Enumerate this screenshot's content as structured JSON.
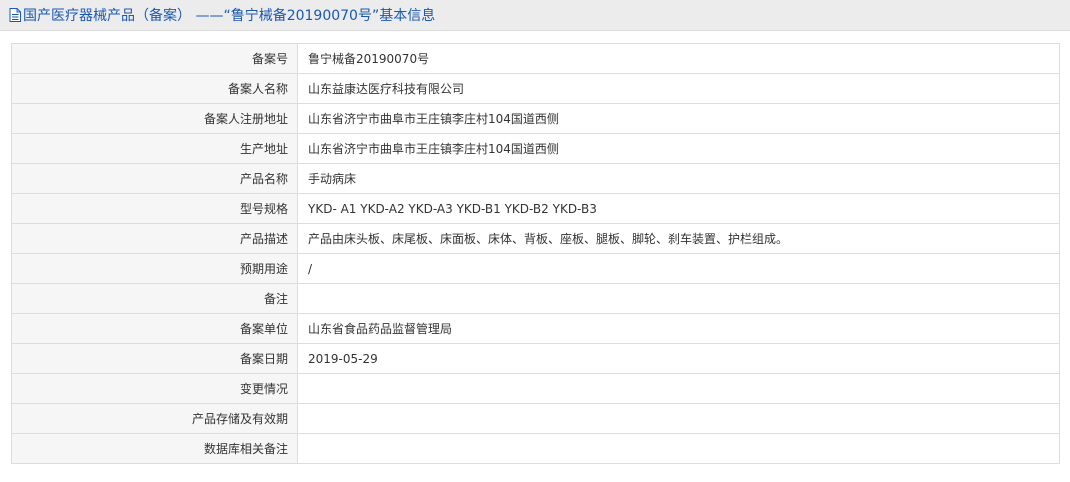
{
  "header": {
    "icon": "document-icon",
    "title": "国产医疗器械产品（备案） ——“鲁宁械备20190070号”基本信息"
  },
  "rows": [
    {
      "label": "备案号",
      "value": "鲁宁械备20190070号"
    },
    {
      "label": "备案人名称",
      "value": "山东益康达医疗科技有限公司"
    },
    {
      "label": "备案人注册地址",
      "value": "山东省济宁市曲阜市王庄镇李庄村104国道西侧"
    },
    {
      "label": "生产地址",
      "value": "山东省济宁市曲阜市王庄镇李庄村104国道西侧"
    },
    {
      "label": "产品名称",
      "value": "手动病床"
    },
    {
      "label": "型号规格",
      "value": "YKD- A1 YKD-A2 YKD-A3 YKD-B1 YKD-B2 YKD-B3"
    },
    {
      "label": "产品描述",
      "value": "产品由床头板、床尾板、床面板、床体、背板、座板、腿板、脚轮、刹车装置、护栏组成。"
    },
    {
      "label": "预期用途",
      "value": "/"
    },
    {
      "label": "备注",
      "value": ""
    },
    {
      "label": "备案单位",
      "value": "山东省食品药品监督管理局"
    },
    {
      "label": "备案日期",
      "value": "2019-05-29"
    },
    {
      "label": "变更情况",
      "value": ""
    },
    {
      "label": "产品存储及有效期",
      "value": ""
    },
    {
      "label": "数据库相关备注",
      "value": ""
    }
  ],
  "colors": {
    "title": "#1a58b4",
    "header_bg": "#ececec",
    "label_bg": "#f6f6f6",
    "border": "#dddddd"
  }
}
